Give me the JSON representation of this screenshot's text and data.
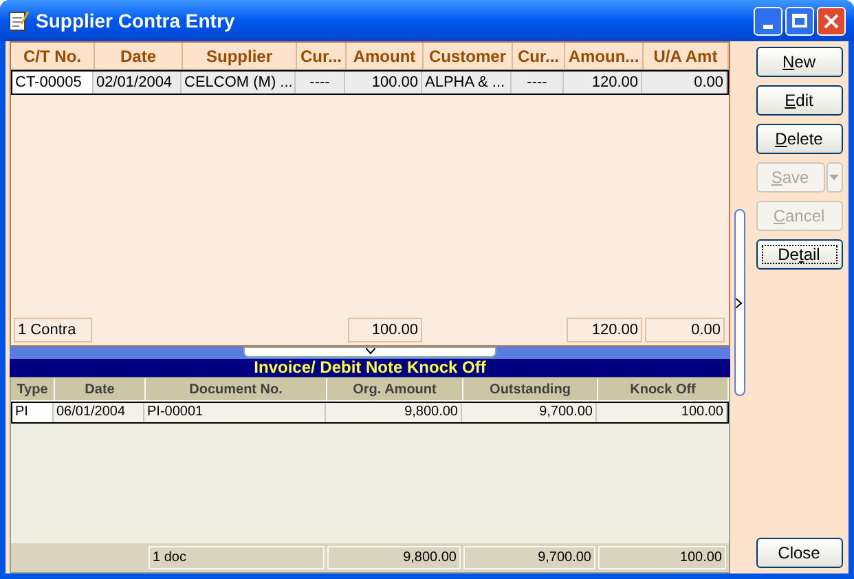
{
  "window": {
    "title": "Supplier Contra Entry"
  },
  "contra_table": {
    "columns": [
      "C/T No.",
      "Date",
      "Supplier",
      "Cur...",
      "Amount",
      "Customer",
      "Cur...",
      "Amoun...",
      "U/A Amt"
    ],
    "rows": [
      {
        "selected": true,
        "cells": [
          "CT-00005",
          "02/01/2004",
          "CELCOM (M) ...",
          "----",
          "100.00",
          "ALPHA & ...",
          "----",
          "120.00",
          "0.00"
        ]
      }
    ],
    "footer": {
      "count": "1 Contra",
      "amount": "100.00",
      "amount_2": "120.00",
      "ua_amt": "0.00"
    }
  },
  "knock_off": {
    "title": "Invoice/ Debit Note Knock Off",
    "columns": [
      "Type",
      "Date",
      "Document No.",
      "Org. Amount",
      "Outstanding",
      "Knock Off"
    ],
    "rows": [
      {
        "selected": true,
        "cells": [
          "PI",
          "06/01/2004",
          "PI-00001",
          "9,800.00",
          "9,700.00",
          "100.00"
        ]
      }
    ],
    "footer": {
      "count": "1 doc",
      "org_amount": "9,800.00",
      "outstanding": "9,700.00",
      "knock_off": "100.00"
    }
  },
  "buttons": [
    {
      "key": "N",
      "post": "ew",
      "disabled": false,
      "focused": false,
      "dropdown": false
    },
    {
      "key": "E",
      "post": "dit",
      "disabled": false,
      "focused": false,
      "dropdown": false
    },
    {
      "key": "D",
      "post": "elete",
      "disabled": false,
      "focused": false,
      "dropdown": false
    },
    {
      "key": "S",
      "post": "ave",
      "disabled": true,
      "focused": false,
      "dropdown": true
    },
    {
      "key": "C",
      "post": "ancel",
      "disabled": true,
      "focused": false,
      "dropdown": false
    },
    {
      "pre": "De",
      "key": "t",
      "post": "ail",
      "disabled": false,
      "focused": true,
      "dropdown": false
    }
  ],
  "close_button": {
    "label": "Close"
  }
}
